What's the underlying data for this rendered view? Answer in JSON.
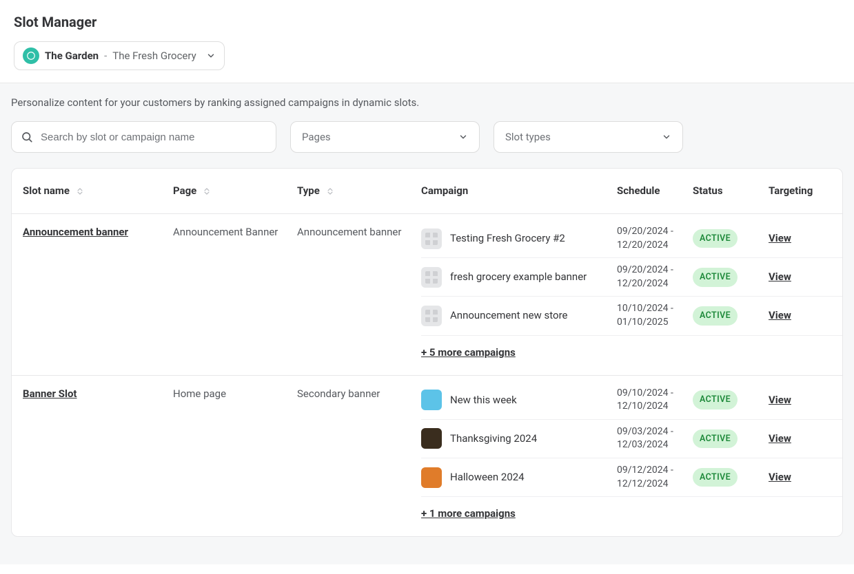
{
  "header": {
    "title": "Slot Manager",
    "site_parent": "The Garden",
    "site_separator": "-",
    "site_child": "The Fresh Grocery"
  },
  "subtitle": "Personalize content for your customers by ranking assigned campaigns in dynamic slots.",
  "filters": {
    "search_placeholder": "Search by slot or campaign name",
    "pages_label": "Pages",
    "slot_types_label": "Slot types"
  },
  "columns": {
    "slot_name": "Slot name",
    "page": "Page",
    "type": "Type",
    "campaign": "Campaign",
    "schedule": "Schedule",
    "status": "Status",
    "targeting": "Targeting"
  },
  "view_label": "View",
  "slots": [
    {
      "name": "Announcement banner",
      "page": "Announcement Banner",
      "type": "Announcement banner",
      "more_label": "+ 5 more campaigns",
      "campaigns": [
        {
          "thumb": "grid",
          "title": "Testing Fresh Grocery #2",
          "schedule": "09/20/2024 - 12/20/2024",
          "status": "ACTIVE"
        },
        {
          "thumb": "grid",
          "title": "fresh grocery example banner",
          "schedule": "09/20/2024 - 12/20/2024",
          "status": "ACTIVE"
        },
        {
          "thumb": "grid",
          "title": "Announcement new store",
          "schedule": "10/10/2024 - 01/10/2025",
          "status": "ACTIVE"
        }
      ]
    },
    {
      "name": "Banner Slot",
      "page": "Home page",
      "type": "Secondary banner",
      "more_label": "+ 1 more campaigns",
      "campaigns": [
        {
          "thumb": "blue",
          "title": "New this week",
          "schedule": "09/10/2024 - 12/10/2024",
          "status": "ACTIVE"
        },
        {
          "thumb": "brown",
          "title": "Thanksgiving 2024",
          "schedule": "09/03/2024 - 12/03/2024",
          "status": "ACTIVE"
        },
        {
          "thumb": "orange",
          "title": "Halloween 2024",
          "schedule": "09/12/2024 - 12/12/2024",
          "status": "ACTIVE"
        }
      ]
    }
  ]
}
